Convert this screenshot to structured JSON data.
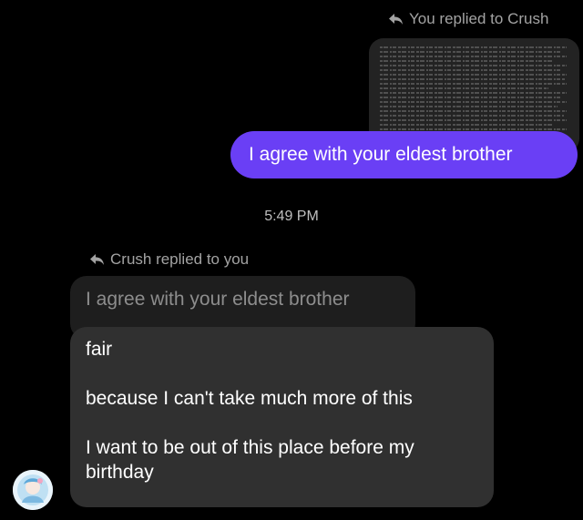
{
  "thread": {
    "you_replied_label": "You replied to Crush",
    "sent_message": "I agree with your eldest brother",
    "timestamp": "5:49 PM",
    "crush_replied_label": "Crush replied to you",
    "quoted_message": "I agree with your eldest brother",
    "received_lines": [
      "fair",
      "because I can't take much more of this",
      "I want to be out of this place before my birthday"
    ]
  },
  "icons": {
    "reply": "reply-arrow-icon",
    "attachment": "image-thumbnail",
    "avatar": "avatar"
  },
  "colors": {
    "background": "#000000",
    "sent_bubble": "#6a3ff5",
    "received_bubble": "#303030",
    "quoted_bubble": "#1e1e1e",
    "meta_text": "#a3a3a3"
  }
}
